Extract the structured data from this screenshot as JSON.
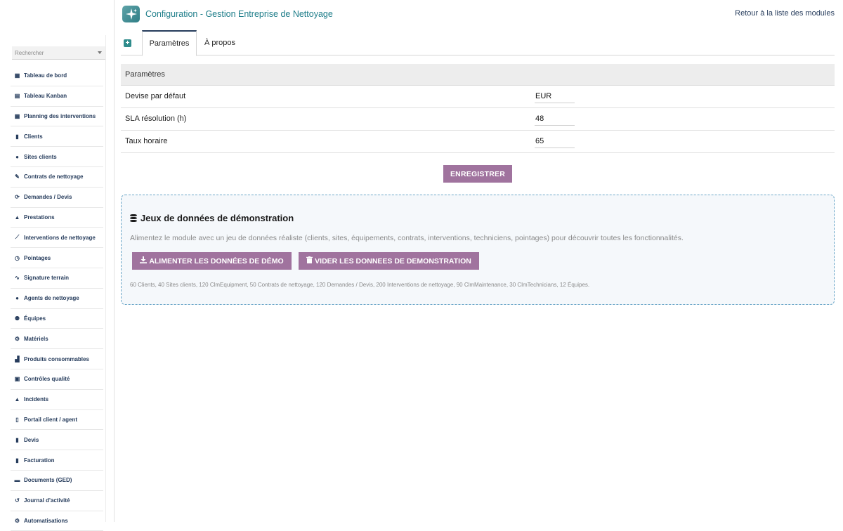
{
  "header": {
    "title": "Configuration - Gestion Entreprise de Nettoyage",
    "back_link": "Retour à la liste des modules"
  },
  "sidebar": {
    "search_placeholder": "Rechercher",
    "items": [
      {
        "label": "Tableau de bord",
        "icon": "dashboard-icon",
        "glyph": "▦"
      },
      {
        "label": "Tableau Kanban",
        "icon": "kanban-icon",
        "glyph": "▤"
      },
      {
        "label": "Planning des interventions",
        "icon": "calendar-icon",
        "glyph": "▦"
      },
      {
        "label": "Clients",
        "icon": "building-icon",
        "glyph": "▮"
      },
      {
        "label": "Sites clients",
        "icon": "map-marker-icon",
        "glyph": "●"
      },
      {
        "label": "Contrats de nettoyage",
        "icon": "contract-icon",
        "glyph": "✎"
      },
      {
        "label": "Demandes / Devis",
        "icon": "request-icon",
        "glyph": "⟳"
      },
      {
        "label": "Prestations",
        "icon": "service-icon",
        "glyph": "▲"
      },
      {
        "label": "Interventions de nettoyage",
        "icon": "broom-icon",
        "glyph": "⟋"
      },
      {
        "label": "Pointages",
        "icon": "clock-icon",
        "glyph": "◷"
      },
      {
        "label": "Signature terrain",
        "icon": "signature-icon",
        "glyph": "∿"
      },
      {
        "label": "Agents de nettoyage",
        "icon": "user-icon",
        "glyph": "●"
      },
      {
        "label": "Équipes",
        "icon": "team-icon",
        "glyph": "⚉"
      },
      {
        "label": "Matériels",
        "icon": "gears-icon",
        "glyph": "⚙"
      },
      {
        "label": "Produits consommables",
        "icon": "spray-icon",
        "glyph": "▟"
      },
      {
        "label": "Contrôles qualité",
        "icon": "clipboard-check-icon",
        "glyph": "▣"
      },
      {
        "label": "Incidents",
        "icon": "warning-icon",
        "glyph": "▲"
      },
      {
        "label": "Portail client / agent",
        "icon": "mobile-icon",
        "glyph": "▯"
      },
      {
        "label": "Devis",
        "icon": "quote-file-icon",
        "glyph": "▮"
      },
      {
        "label": "Facturation",
        "icon": "invoice-icon",
        "glyph": "▮"
      },
      {
        "label": "Documents (GED)",
        "icon": "folder-icon",
        "glyph": "▬"
      },
      {
        "label": "Journal d'activité",
        "icon": "history-icon",
        "glyph": "↺"
      },
      {
        "label": "Automatisations",
        "icon": "automation-icon",
        "glyph": "⚙"
      }
    ]
  },
  "tabs": {
    "active": "Paramètres",
    "about": "À propos"
  },
  "params": {
    "header": "Paramètres",
    "rows": [
      {
        "label": "Devise par défaut",
        "value": "EUR"
      },
      {
        "label": "SLA résolution (h)",
        "value": "48"
      },
      {
        "label": "Taux horaire",
        "value": "65"
      }
    ],
    "save_label": "ENREGISTRER"
  },
  "demo": {
    "title": "Jeux de données de démonstration",
    "description": "Alimentez le module avec un jeu de données réaliste (clients, sites, équipements, contrats, interventions, techniciens, pointages) pour découvrir toutes les fonctionnalités.",
    "load_label": "ALIMENTER LES DONNÉES DE DÉMO",
    "clear_label": "VIDER LES DONNEES DE DEMONSTRATION",
    "stats": "60 Clients, 40 Sites clients, 120 ClmEquipment, 50 Contrats de nettoyage, 120 Demandes / Devis, 200 Interventions de nettoyage, 90 ClmMaintenance, 30 ClmTechnicians, 12 Équipes."
  },
  "colors": {
    "accent": "#a0739e",
    "title": "#1f7e8a",
    "nav_text": "#263c5c",
    "panel_border": "#6aa6c8"
  }
}
